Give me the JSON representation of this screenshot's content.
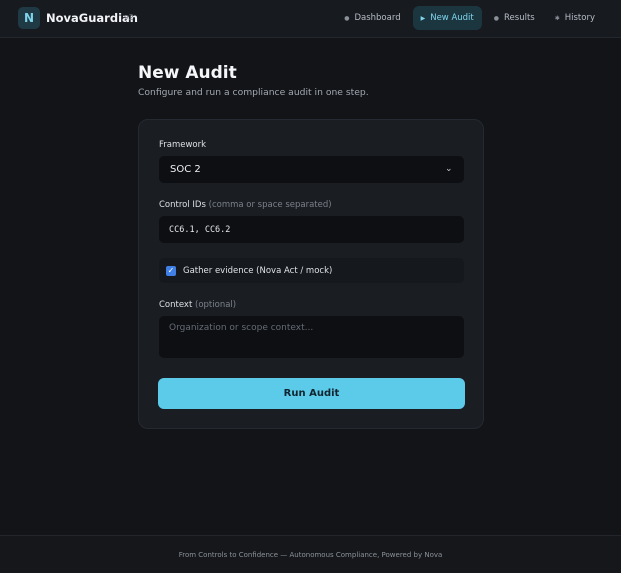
{
  "app": {
    "logo_letter": "N",
    "name": "NovaGuardian",
    "version": "v2"
  },
  "nav": {
    "items": [
      {
        "label": "Dashboard",
        "icon": "dot-icon",
        "active": false
      },
      {
        "label": "New Audit",
        "icon": "play-icon",
        "active": true
      },
      {
        "label": "Results",
        "icon": "dot-icon",
        "active": false
      },
      {
        "label": "History",
        "icon": "sparkle-icon",
        "active": false
      }
    ]
  },
  "page": {
    "title": "New Audit",
    "subtitle": "Configure and run a compliance audit in one step."
  },
  "form": {
    "framework_label": "Framework",
    "framework_value": "SOC 2",
    "controls_label": "Control IDs",
    "controls_hint": "(comma or space separated)",
    "controls_value": "CC6.1, CC6.2",
    "evidence_label": "Gather evidence (Nova Act / mock)",
    "evidence_checked": true,
    "context_label": "Context",
    "context_hint": "(optional)",
    "context_placeholder": "Organization or scope context...",
    "run_button": "Run Audit"
  },
  "footer": {
    "text": "From Controls to Confidence — Autonomous Compliance, Powered by Nova"
  },
  "colors": {
    "accent": "#5ccbea",
    "background": "#121418",
    "card": "#1a1d22",
    "checkbox": "#3f7fe6"
  }
}
